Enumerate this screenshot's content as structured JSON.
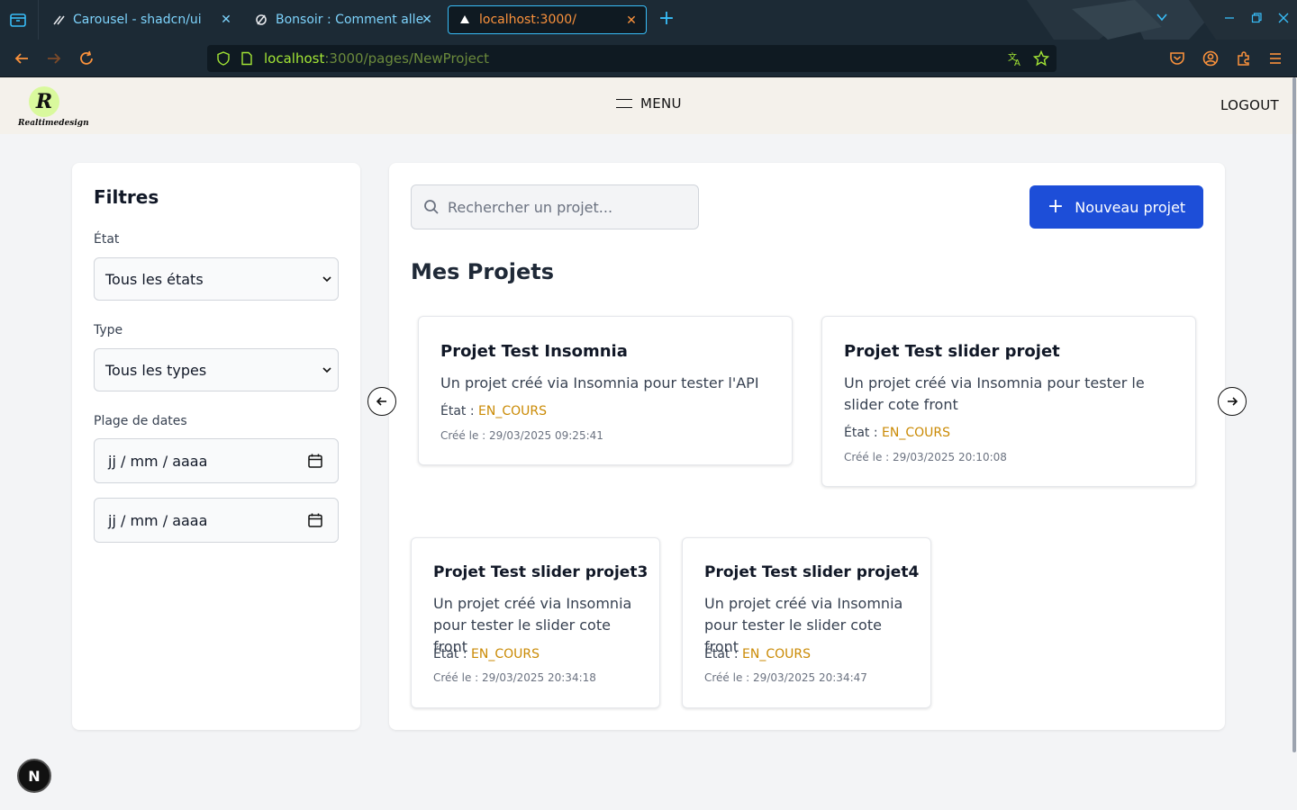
{
  "browser": {
    "tabs": [
      {
        "title": "Carousel - shadcn/ui",
        "active": false
      },
      {
        "title": "Bonsoir : Comment allez",
        "active": false
      },
      {
        "title": "localhost:3000/",
        "active": true
      }
    ],
    "url_host": "localhost",
    "url_path": ":3000/pages/NewProject"
  },
  "header": {
    "logo_letter": "R",
    "logo_text": "Realtimedesign",
    "menu_label": "MENU",
    "logout_label": "LOGOUT"
  },
  "filters": {
    "title": "Filtres",
    "state_label": "État",
    "state_value": "Tous les états",
    "type_label": "Type",
    "type_value": "Tous les types",
    "date_range_label": "Plage de dates",
    "date_start": "jj / mm / aaaa",
    "date_end": "jj / mm / aaaa"
  },
  "main": {
    "search_placeholder": "Rechercher un projet...",
    "new_project_label": "Nouveau projet",
    "title": "Mes Projets",
    "state_prefix": "État :",
    "projects": [
      {
        "title": "Projet Test Insomnia",
        "description": "Un projet créé via Insomnia pour tester l'API",
        "state": "EN_COURS",
        "created": "Créé le : 29/03/2025 09:25:41"
      },
      {
        "title": "Projet Test slider projet",
        "description": "Un projet créé via Insomnia pour tester le slider cote front",
        "state": "EN_COURS",
        "created": "Créé le : 29/03/2025 20:10:08"
      },
      {
        "title": "Projet Test slider projet3",
        "description": "Un projet créé via Insomnia pour tester le slider cote front",
        "state": "EN_COURS",
        "created": "Créé le : 29/03/2025 20:34:18"
      },
      {
        "title": "Projet Test slider projet4",
        "description": "Un projet créé via Insomnia pour tester le slider cote front",
        "state": "EN_COURS",
        "created": "Créé le : 29/03/2025 20:34:47"
      }
    ]
  },
  "dev_badge": "N",
  "colors": {
    "accent": "#1d4ed8",
    "state": "#ca8a04",
    "browser_chrome": "#1c2a35",
    "url_text": "#a3e635"
  },
  "icons": [
    "tab-list-icon",
    "shadcn-favicon",
    "sync-favicon",
    "vercel-favicon",
    "close-icon",
    "plus-icon",
    "chevron-down-icon",
    "minimize-icon",
    "maximize-icon",
    "window-close-icon",
    "back-icon",
    "forward-icon",
    "reload-icon",
    "shield-icon",
    "page-icon",
    "translate-icon",
    "star-icon",
    "pocket-icon",
    "account-icon",
    "extensions-icon",
    "hamburger-icon",
    "search-icon",
    "calendar-icon",
    "arrow-left-icon",
    "arrow-right-icon"
  ]
}
